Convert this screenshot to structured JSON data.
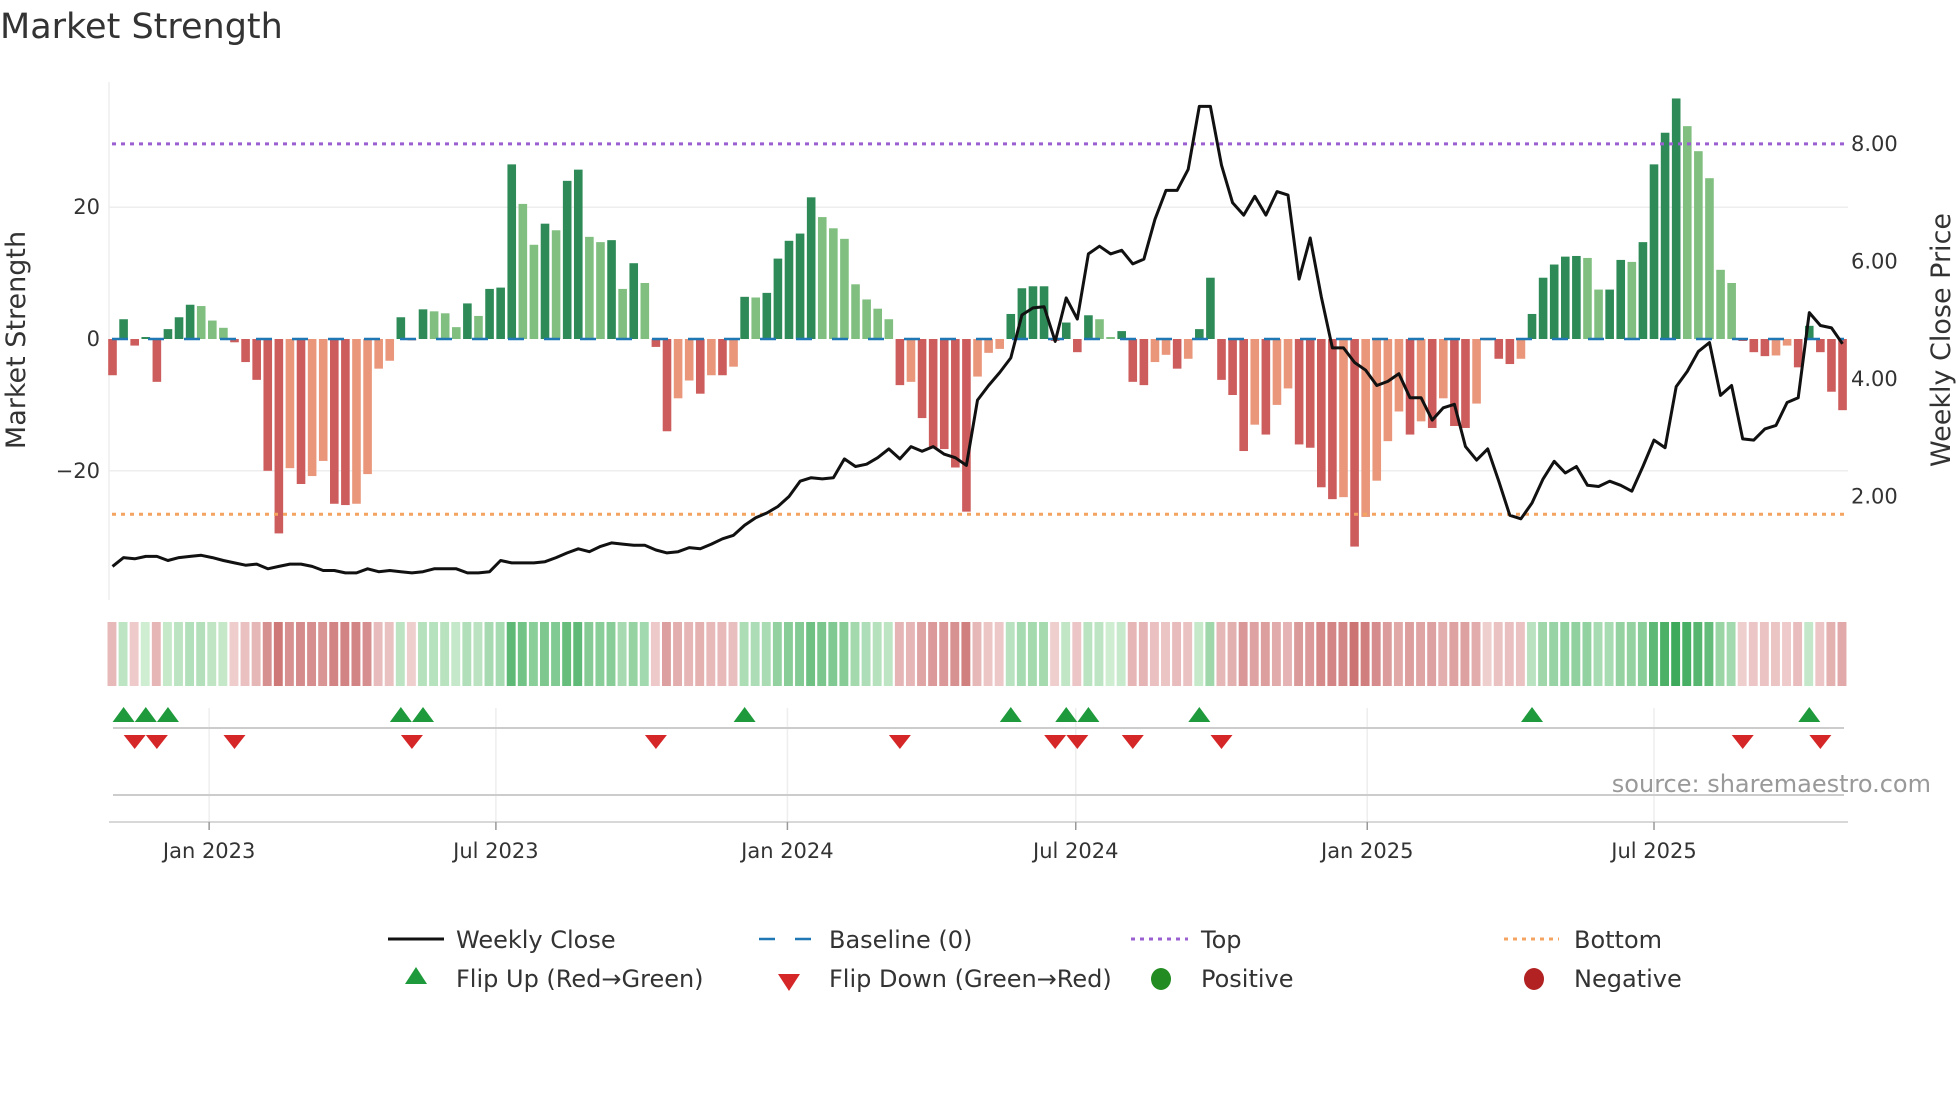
{
  "chart_data": {
    "type": "bar",
    "title": "Market Strength",
    "ylabel": "Market Strength",
    "y2label": "Weekly Close Price",
    "ylim": [
      -35,
      40
    ],
    "y2lim": [
      0.3,
      9.0
    ],
    "yticks": [
      "20",
      "0",
      "−20"
    ],
    "ytick_values": [
      20,
      0,
      -20
    ],
    "y2ticks": [
      "8.00",
      "6.00",
      "4.00",
      "2.00"
    ],
    "y2tick_values": [
      8,
      6,
      4,
      2
    ],
    "xticks": [
      {
        "label": "Jan 2023",
        "date": "2023-01-01"
      },
      {
        "label": "Jul 2023",
        "date": "2023-07-01"
      },
      {
        "label": "Jan 2024",
        "date": "2024-01-01"
      },
      {
        "label": "Jul 2024",
        "date": "2024-07-01"
      },
      {
        "label": "Jan 2025",
        "date": "2025-01-01"
      },
      {
        "label": "Jul 2025",
        "date": "2025-07-01"
      }
    ],
    "start_week": "2022-11-01",
    "frequency": "weekly",
    "top_level": 29.6,
    "bottom_level": -26.6,
    "baseline": 0,
    "strength": [
      -5.5,
      3,
      -1,
      0.3,
      -6.5,
      1.5,
      3.3,
      5.2,
      5,
      2.8,
      1.7,
      -0.5,
      -3.5,
      -6.2,
      -20,
      -29.5,
      -19.6,
      -22,
      -20.8,
      -18.5,
      -25,
      -25.2,
      -25,
      -20.5,
      -4.5,
      -3.3,
      3.3,
      -0.2,
      4.5,
      4.2,
      3.9,
      1.8,
      5.4,
      3.5,
      7.6,
      7.8,
      26.5,
      20.5,
      14.3,
      17.5,
      16.5,
      24,
      25.7,
      15.5,
      14.7,
      15,
      7.6,
      11.5,
      8.5,
      -1.2,
      -14,
      -9,
      -6.3,
      -8.3,
      -5.5,
      -5.5,
      -4.2,
      6.4,
      6.3,
      7,
      12.2,
      14.9,
      16,
      21.5,
      18.5,
      16.8,
      15.2,
      8.3,
      6,
      4.6,
      3,
      -7,
      -6.5,
      -12,
      -16.5,
      -16.7,
      -19.5,
      -26.2,
      -5.7,
      -2.1,
      -1.5,
      3.8,
      7.7,
      8,
      8,
      -0.3,
      2.5,
      -2,
      3.6,
      3,
      0.3,
      1.2,
      -6.5,
      -7,
      -3.5,
      -2.4,
      -4.5,
      -3,
      1.5,
      9.3,
      -6.2,
      -8.5,
      -17,
      -13,
      -14.5,
      -10,
      -7.5,
      -16,
      -16.5,
      -22.5,
      -24.3,
      -24,
      -31.5,
      -27,
      -21.5,
      -15.5,
      -11,
      -14.5,
      -12.5,
      -13.5,
      -9,
      -13.2,
      -13.5,
      -9.8,
      -0.2,
      -3,
      -3.8,
      -3,
      3.8,
      9.3,
      11.3,
      12.5,
      12.6,
      12.3,
      7.5,
      7.5,
      12,
      11.7,
      14.7,
      26.5,
      31.3,
      36.5,
      32.3,
      28.5,
      24.4,
      10.5,
      8.5,
      -0.3,
      -2,
      -2.6,
      -2.5,
      -1,
      -4.3,
      2,
      -2,
      -8,
      -10.8
    ],
    "weekly_close": [
      0.81,
      0.96,
      0.94,
      0.98,
      0.98,
      0.91,
      0.96,
      0.98,
      1.0,
      0.96,
      0.91,
      0.87,
      0.83,
      0.85,
      0.77,
      0.81,
      0.85,
      0.85,
      0.81,
      0.74,
      0.74,
      0.7,
      0.7,
      0.77,
      0.72,
      0.74,
      0.72,
      0.7,
      0.72,
      0.77,
      0.77,
      0.77,
      0.7,
      0.7,
      0.72,
      0.91,
      0.87,
      0.87,
      0.87,
      0.89,
      0.96,
      1.04,
      1.11,
      1.06,
      1.15,
      1.21,
      1.19,
      1.17,
      1.17,
      1.09,
      1.04,
      1.06,
      1.13,
      1.11,
      1.19,
      1.28,
      1.34,
      1.51,
      1.64,
      1.72,
      1.83,
      2.0,
      2.26,
      2.32,
      2.3,
      2.32,
      2.64,
      2.51,
      2.55,
      2.66,
      2.81,
      2.64,
      2.85,
      2.77,
      2.85,
      2.72,
      2.66,
      2.53,
      3.64,
      3.89,
      4.11,
      4.36,
      5.09,
      5.21,
      5.23,
      4.64,
      5.38,
      5.02,
      6.13,
      6.26,
      6.13,
      6.19,
      5.96,
      6.04,
      6.72,
      7.21,
      7.21,
      7.57,
      8.64,
      8.64,
      7.64,
      7.0,
      6.79,
      7.11,
      6.79,
      7.19,
      7.13,
      5.7,
      6.4,
      5.4,
      4.53,
      4.53,
      4.28,
      4.15,
      3.89,
      3.96,
      4.09,
      3.68,
      3.68,
      3.3,
      3.51,
      3.57,
      2.85,
      2.62,
      2.81,
      2.26,
      1.68,
      1.62,
      1.89,
      2.3,
      2.6,
      2.4,
      2.51,
      2.19,
      2.17,
      2.26,
      2.19,
      2.09,
      2.51,
      2.96,
      2.83,
      3.87,
      4.13,
      4.47,
      4.62,
      3.72,
      3.89,
      2.98,
      2.96,
      3.15,
      3.21,
      3.6,
      3.68,
      5.13,
      4.91,
      4.87,
      4.6
    ],
    "flip_up_weeks": [
      1,
      3,
      5,
      26,
      28,
      57,
      81,
      86,
      88,
      98,
      128,
      153
    ],
    "flip_down_weeks": [
      2,
      4,
      11,
      27,
      49,
      71,
      85,
      87,
      92,
      100,
      147,
      154
    ],
    "legend": {
      "placement": "bottom",
      "weekly_close": "Weekly Close",
      "baseline": "Baseline (0)",
      "top": "Top",
      "bottom": "Bottom",
      "flip_up": "Flip Up (Red→Green)",
      "flip_down": "Flip Down (Green→Red)",
      "positive": "Positive",
      "negative": "Negative"
    },
    "colors": {
      "pos_strong": "#2e8b57",
      "pos_weak": "#80bf80",
      "neg_strong": "#cd5c5c",
      "neg_weak": "#e9967a",
      "baseline": "#1f77b4",
      "top": "#9a5fd0",
      "bottom": "#f4a460",
      "close": "#111111",
      "flip_up": "#1e9a3c",
      "flip_down": "#d62728",
      "positive": "#228b22",
      "negative": "#b22222"
    }
  },
  "source": "source: sharemaestro.com"
}
